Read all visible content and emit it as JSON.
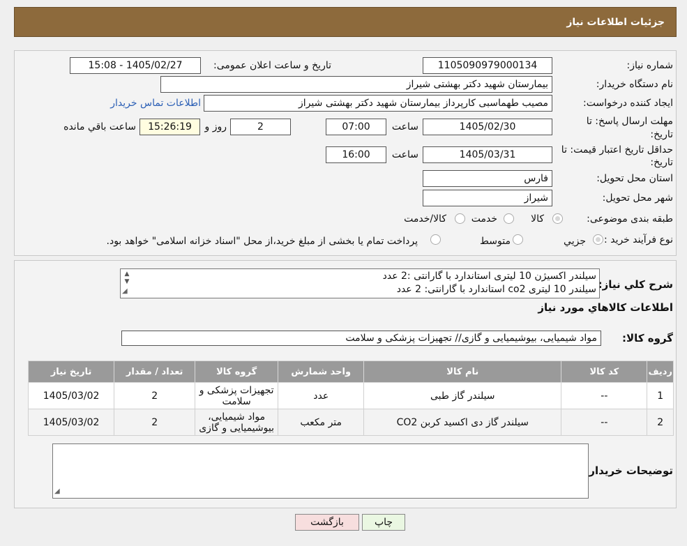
{
  "header": {
    "title": "جزئیات اطلاعات نیاز"
  },
  "form": {
    "need_number_label": "شماره نیاز:",
    "need_number": "1105090979000134",
    "announce_label": "تاریخ و ساعت اعلان عمومی:",
    "announce_value": "1405/02/27 - 15:08",
    "buyer_org_label": "نام دستگاه خریدار:",
    "buyer_org": "بیمارستان شهید دکتر بهشتی شیراز",
    "creator_label": "ایجاد کننده درخواست:",
    "creator": "مصیب طهماسبی کارپرداز بیمارستان شهید دکتر بهشتی شیراز",
    "contact_link": "اطلاعات تماس خریدار",
    "deadline_label_1": "مهلت ارسال پاسخ: تا",
    "deadline_label_2": "تاریخ:",
    "deadline_date": "1405/02/30",
    "hour_label": "ساعت",
    "deadline_time": "07:00",
    "days_value": "2",
    "days_label": "روز و",
    "remaining_time": "15:26:19",
    "remaining_label": "ساعت باقي مانده",
    "validity_label_1": "حداقل تاریخ اعتبار قیمت: تا",
    "validity_label_2": "تاریخ:",
    "validity_date": "1405/03/31",
    "validity_time": "16:00",
    "province_label": "استان محل تحویل:",
    "province": "فارس",
    "city_label": "شهر محل تحویل:",
    "city": "شیراز",
    "category_label": "طبقه بندی موضوعی:",
    "category_options": [
      "کالا",
      "خدمت",
      "کالا/خدمت"
    ],
    "process_label": "نوع فرآیند خرید :",
    "process_options": [
      "جزیي",
      "متوسط"
    ],
    "process_note": "پرداخت تمام یا بخشی از مبلغ خرید،از محل \"اسناد خزانه اسلامی\" خواهد بود."
  },
  "description": {
    "label": "شرح کلي نیاز:",
    "lines": [
      "سیلندر اکسیژن 10 لیتری استاندارد با گارانتی :2 عدد",
      "سیلندر 10 لیتری co2 استاندارد با گارانتی: 2 عدد"
    ]
  },
  "goods_section_title": "اطلاعات کالاهاي مورد نیاز",
  "goods_group": {
    "label": "گروه کالا:",
    "value": "مواد شیمیایی، بیوشیمیایی و  گازی// تجهیزات پزشکی و سلامت"
  },
  "table": {
    "headers": [
      "ردیف",
      "کد کالا",
      "نام کالا",
      "واحد شمارش",
      "گروه کالا",
      "تعداد / مقدار",
      "تاریخ نیاز"
    ],
    "rows": [
      {
        "row": "1",
        "code": "--",
        "name": "سیلندر گاز طبی",
        "unit": "عدد",
        "group": "تجهیزات پزشکی و سلامت",
        "qty": "2",
        "date": "1405/03/02"
      },
      {
        "row": "2",
        "code": "--",
        "name": "سیلندر گاز دی اکسید کربن CO2",
        "unit": "متر مکعب",
        "group": "مواد شیمیایی، بیوشیمیایی و گازی",
        "qty": "2",
        "date": "1405/03/02"
      }
    ]
  },
  "buyer_notes": {
    "label": "توضیحات خریدار:"
  },
  "buttons": {
    "print": "چاپ",
    "back": "بازگشت"
  },
  "colors": {
    "header_bg": "#8d6a3c",
    "table_header_bg": "#9a9a9a",
    "link": "#2b5fb5",
    "back_button_bg": "#f7dede",
    "print_button_bg": "#eaf7e2"
  }
}
